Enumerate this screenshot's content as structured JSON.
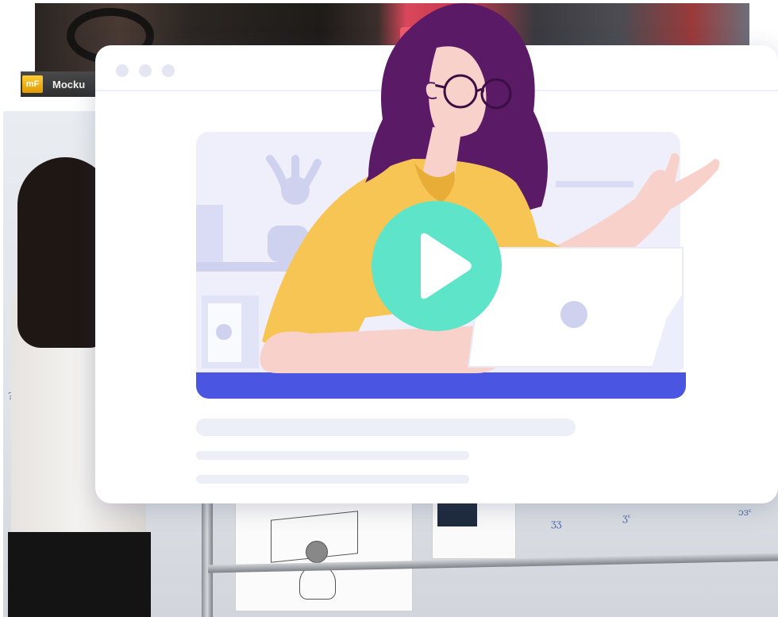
{
  "background": {
    "toolbar": {
      "logo_text": "mF",
      "app_label": "Mocku"
    }
  },
  "card": {
    "window_dots": [
      "dot-1",
      "dot-2",
      "dot-3"
    ],
    "play_icon": "play-icon",
    "colors": {
      "accent_blue": "#4a56e2",
      "play_mint": "#5ee4c8",
      "sweater_yellow": "#f7c553",
      "hair_purple": "#5a1a66",
      "placeholder_lavender": "#eceef8"
    }
  }
}
